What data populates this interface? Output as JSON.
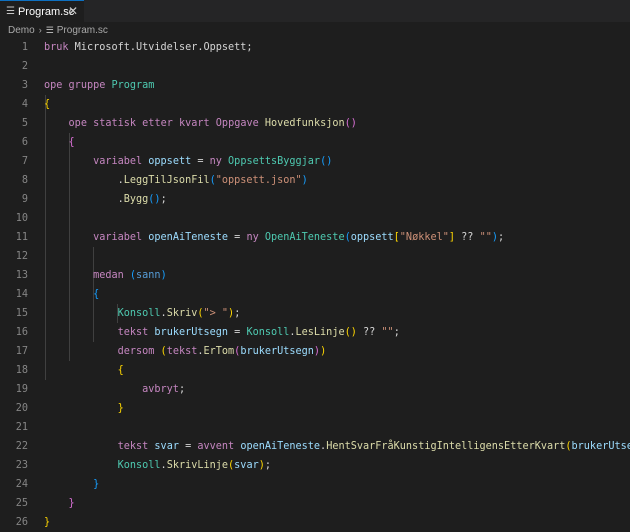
{
  "tab": {
    "title": "Program.sc",
    "close_glyph": "✕",
    "icon": "file-lines-icon"
  },
  "breadcrumb": {
    "folder": "Demo",
    "separator": "›",
    "file": "Program.sc"
  },
  "editor": {
    "lines": [
      {
        "n": "1",
        "tokens": [
          [
            "kw",
            "bruk "
          ],
          [
            "pl",
            "Microsoft.Utvidelser.Oppsett;"
          ]
        ]
      },
      {
        "n": "2",
        "tokens": []
      },
      {
        "n": "3",
        "tokens": [
          [
            "kw",
            "ope "
          ],
          [
            "kw",
            "gruppe "
          ],
          [
            "ty",
            "Program"
          ]
        ]
      },
      {
        "n": "4",
        "tokens": [
          [
            "br1",
            "{"
          ]
        ]
      },
      {
        "n": "5",
        "tokens": [
          [
            "pl",
            "    "
          ],
          [
            "kw",
            "ope "
          ],
          [
            "kw",
            "statisk "
          ],
          [
            "kw",
            "etter "
          ],
          [
            "kw",
            "kvart "
          ],
          [
            "kw",
            "Oppgave "
          ],
          [
            "fn",
            "Hovedfunksjon"
          ],
          [
            "br2",
            "()"
          ]
        ]
      },
      {
        "n": "6",
        "tokens": [
          [
            "pl",
            "    "
          ],
          [
            "br2",
            "{"
          ]
        ]
      },
      {
        "n": "7",
        "tokens": [
          [
            "pl",
            "        "
          ],
          [
            "kw",
            "variabel "
          ],
          [
            "va",
            "oppsett "
          ],
          [
            "pl",
            "= "
          ],
          [
            "kw",
            "ny "
          ],
          [
            "ty",
            "OppsettsByggjar"
          ],
          [
            "br3",
            "()"
          ]
        ]
      },
      {
        "n": "8",
        "tokens": [
          [
            "pl",
            "            ."
          ],
          [
            "fn",
            "LeggTilJsonFil"
          ],
          [
            "br3",
            "("
          ],
          [
            "st",
            "\"oppsett.json\""
          ],
          [
            "br3",
            ")"
          ]
        ]
      },
      {
        "n": "9",
        "tokens": [
          [
            "pl",
            "            ."
          ],
          [
            "fn",
            "Bygg"
          ],
          [
            "br3",
            "()"
          ],
          [
            "pl",
            ";"
          ]
        ]
      },
      {
        "n": "10",
        "tokens": []
      },
      {
        "n": "11",
        "tokens": [
          [
            "pl",
            "        "
          ],
          [
            "kw",
            "variabel "
          ],
          [
            "va",
            "openAiTeneste "
          ],
          [
            "pl",
            "= "
          ],
          [
            "kw",
            "ny "
          ],
          [
            "ty",
            "OpenAiTeneste"
          ],
          [
            "br3",
            "("
          ],
          [
            "va",
            "oppsett"
          ],
          [
            "br1",
            "["
          ],
          [
            "st",
            "\"Nøkkel\""
          ],
          [
            "br1",
            "]"
          ],
          [
            "pl",
            " ?? "
          ],
          [
            "st",
            "\"\""
          ],
          [
            "br3",
            ")"
          ],
          [
            "pl",
            ";"
          ]
        ]
      },
      {
        "n": "12",
        "tokens": []
      },
      {
        "n": "13",
        "tokens": [
          [
            "pl",
            "        "
          ],
          [
            "kw",
            "medan "
          ],
          [
            "br3",
            "("
          ],
          [
            "bl",
            "sann"
          ],
          [
            "br3",
            ")"
          ]
        ]
      },
      {
        "n": "14",
        "tokens": [
          [
            "pl",
            "        "
          ],
          [
            "br3",
            "{"
          ]
        ]
      },
      {
        "n": "15",
        "tokens": [
          [
            "pl",
            "            "
          ],
          [
            "ty",
            "Konsoll"
          ],
          [
            "pl",
            "."
          ],
          [
            "fn",
            "Skriv"
          ],
          [
            "br1",
            "("
          ],
          [
            "st",
            "\"> \""
          ],
          [
            "br1",
            ")"
          ],
          [
            "pl",
            ";"
          ]
        ]
      },
      {
        "n": "16",
        "tokens": [
          [
            "pl",
            "            "
          ],
          [
            "kw",
            "tekst "
          ],
          [
            "va",
            "brukerUtsegn "
          ],
          [
            "pl",
            "= "
          ],
          [
            "ty",
            "Konsoll"
          ],
          [
            "pl",
            "."
          ],
          [
            "fn",
            "LesLinje"
          ],
          [
            "br1",
            "()"
          ],
          [
            "pl",
            " ?? "
          ],
          [
            "st",
            "\"\""
          ],
          [
            "pl",
            ";"
          ]
        ]
      },
      {
        "n": "17",
        "tokens": [
          [
            "pl",
            "            "
          ],
          [
            "kw",
            "dersom "
          ],
          [
            "br1",
            "("
          ],
          [
            "kw",
            "tekst"
          ],
          [
            "pl",
            "."
          ],
          [
            "fn",
            "ErTom"
          ],
          [
            "br2",
            "("
          ],
          [
            "va",
            "brukerUtsegn"
          ],
          [
            "br2",
            ")"
          ],
          [
            "br1",
            ")"
          ]
        ]
      },
      {
        "n": "18",
        "tokens": [
          [
            "pl",
            "            "
          ],
          [
            "br1",
            "{"
          ]
        ]
      },
      {
        "n": "19",
        "tokens": [
          [
            "pl",
            "                "
          ],
          [
            "kw",
            "avbryt"
          ],
          [
            "pl",
            ";"
          ]
        ]
      },
      {
        "n": "20",
        "tokens": [
          [
            "pl",
            "            "
          ],
          [
            "br1",
            "}"
          ]
        ]
      },
      {
        "n": "21",
        "tokens": []
      },
      {
        "n": "22",
        "tokens": [
          [
            "pl",
            "            "
          ],
          [
            "kw",
            "tekst "
          ],
          [
            "va",
            "svar "
          ],
          [
            "pl",
            "= "
          ],
          [
            "kw",
            "avvent "
          ],
          [
            "va",
            "openAiTeneste"
          ],
          [
            "pl",
            "."
          ],
          [
            "fn",
            "HentSvarFråKunstigIntelligensEtterKvart"
          ],
          [
            "br1",
            "("
          ],
          [
            "va",
            "brukerUtsegn"
          ],
          [
            "br1",
            ")"
          ],
          [
            "pl",
            ";"
          ]
        ]
      },
      {
        "n": "23",
        "tokens": [
          [
            "pl",
            "            "
          ],
          [
            "ty",
            "Konsoll"
          ],
          [
            "pl",
            "."
          ],
          [
            "fn",
            "SkrivLinje"
          ],
          [
            "br1",
            "("
          ],
          [
            "va",
            "svar"
          ],
          [
            "br1",
            ")"
          ],
          [
            "pl",
            ";"
          ]
        ]
      },
      {
        "n": "24",
        "tokens": [
          [
            "pl",
            "        "
          ],
          [
            "br3",
            "}"
          ]
        ]
      },
      {
        "n": "25",
        "tokens": [
          [
            "pl",
            "    "
          ],
          [
            "br2",
            "}"
          ]
        ]
      },
      {
        "n": "26",
        "tokens": [
          [
            "br1",
            "}"
          ]
        ]
      }
    ]
  }
}
